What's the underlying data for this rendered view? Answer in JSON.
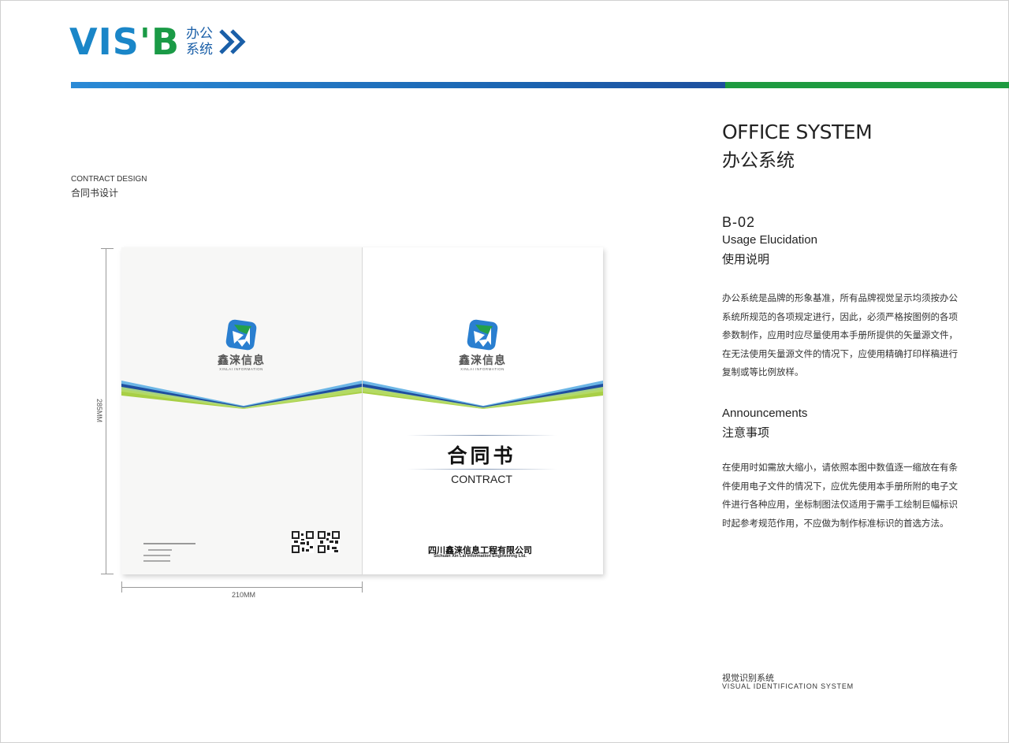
{
  "header": {
    "logo_vis": "VIS",
    "logo_apos": "'",
    "logo_b": "B",
    "logo_cn_line1": "办公",
    "logo_cn_line2": "系统",
    "colors": {
      "blue": "#1a86c8",
      "green": "#1a9a46",
      "bar_blue": "#1a63b0",
      "bar_green": "#1e9a40"
    }
  },
  "section": {
    "title_en": "CONTRACT DESIGN",
    "title_cn": "合同书设计"
  },
  "dimensions": {
    "height_label": "285MM",
    "width_label": "210MM"
  },
  "mockup": {
    "brand_cn": "鑫涞信息",
    "brand_en": "XINLAI INFORMATION",
    "contract_cn": "合同书",
    "contract_en": "CONTRACT",
    "company_cn": "四川鑫涞信息工程有限公司",
    "company_en": "Sichuan Xin Lai Information Engineering Ltd.",
    "icons": [
      "brand-emblem-icon",
      "qr-code-icon"
    ]
  },
  "info": {
    "title_en": "OFFICE SYSTEM",
    "title_cn": "办公系统",
    "code": "B-02",
    "usage_en": "Usage Elucidation",
    "usage_cn": "使用说明",
    "usage_text": "办公系统是品牌的形象基准，所有品牌视觉呈示均须按办公系统所规范的各项规定进行，因此，必须严格按图例的各项参数制作，应用时应尽量使用本手册所提供的矢量源文件，在无法使用矢量源文件的情况下，应使用精确打印样稿进行复制或等比例放样。",
    "ann_en": "Announcements",
    "ann_cn": "注意事项",
    "ann_text": "在使用时如需放大缩小，请依照本图中数值逐一缩放在有条件使用电子文件的情况下，应优先使用本手册所附的电子文件进行各种应用，坐标制图法仅适用于需手工绘制巨幅标识时起参考规范作用，不应做为制作标准标识的首选方法。",
    "footer_cn": "视觉识别系统",
    "footer_en": "VISUAL IDENTIFICATION SYSTEM"
  }
}
